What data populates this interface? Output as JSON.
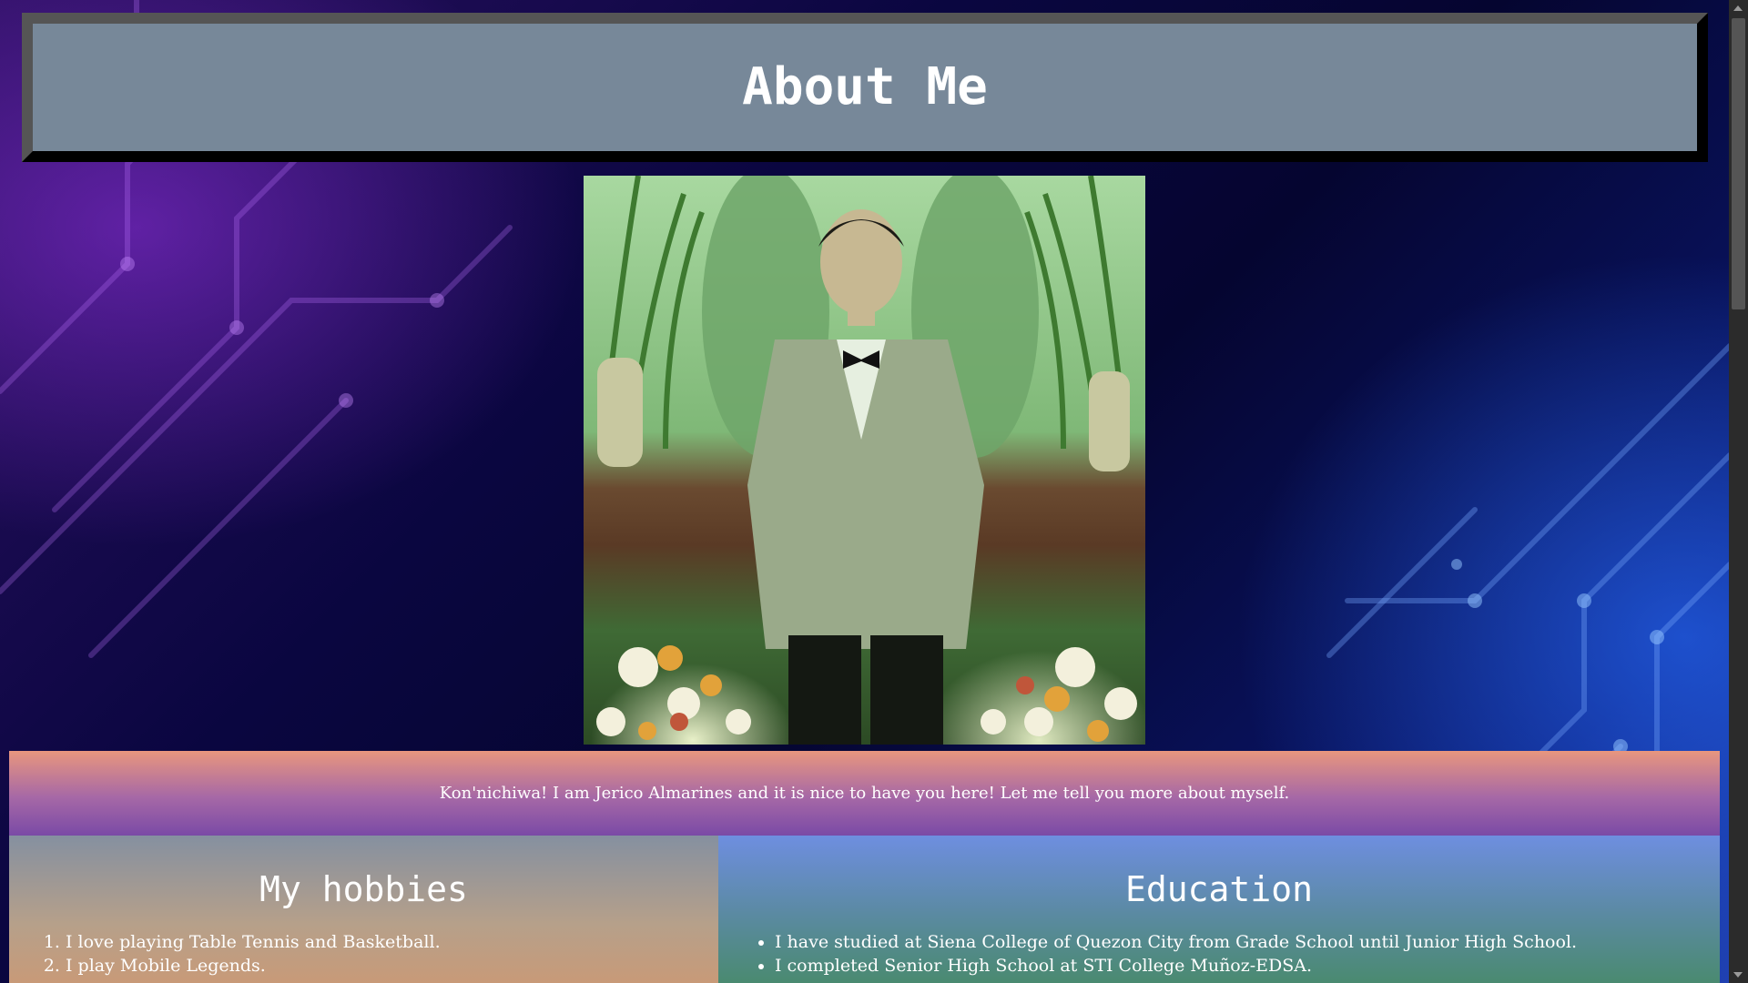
{
  "header": {
    "title": "About Me"
  },
  "intro": {
    "text": "Kon'nichiwa! I am Jerico Almarines and it is nice to have you here! Let me tell you more about myself."
  },
  "hobbies": {
    "title": "My hobbies",
    "items": [
      "I love playing Table Tennis and Basketball.",
      "I play Mobile Legends."
    ]
  },
  "education": {
    "title": "Education",
    "items": [
      "I have studied at Siena College of Quezon City from Grade School until Junior High School.",
      "I completed Senior High School at STI College Muñoz-EDSA."
    ]
  },
  "colors": {
    "header_bg": "#778899",
    "intro_gradient_top": "#e8967e",
    "intro_gradient_bottom": "#7a4aa6",
    "text": "#ffffff"
  },
  "icons": {
    "scroll_up": "chevron-up-icon",
    "scroll_down": "chevron-down-icon"
  }
}
